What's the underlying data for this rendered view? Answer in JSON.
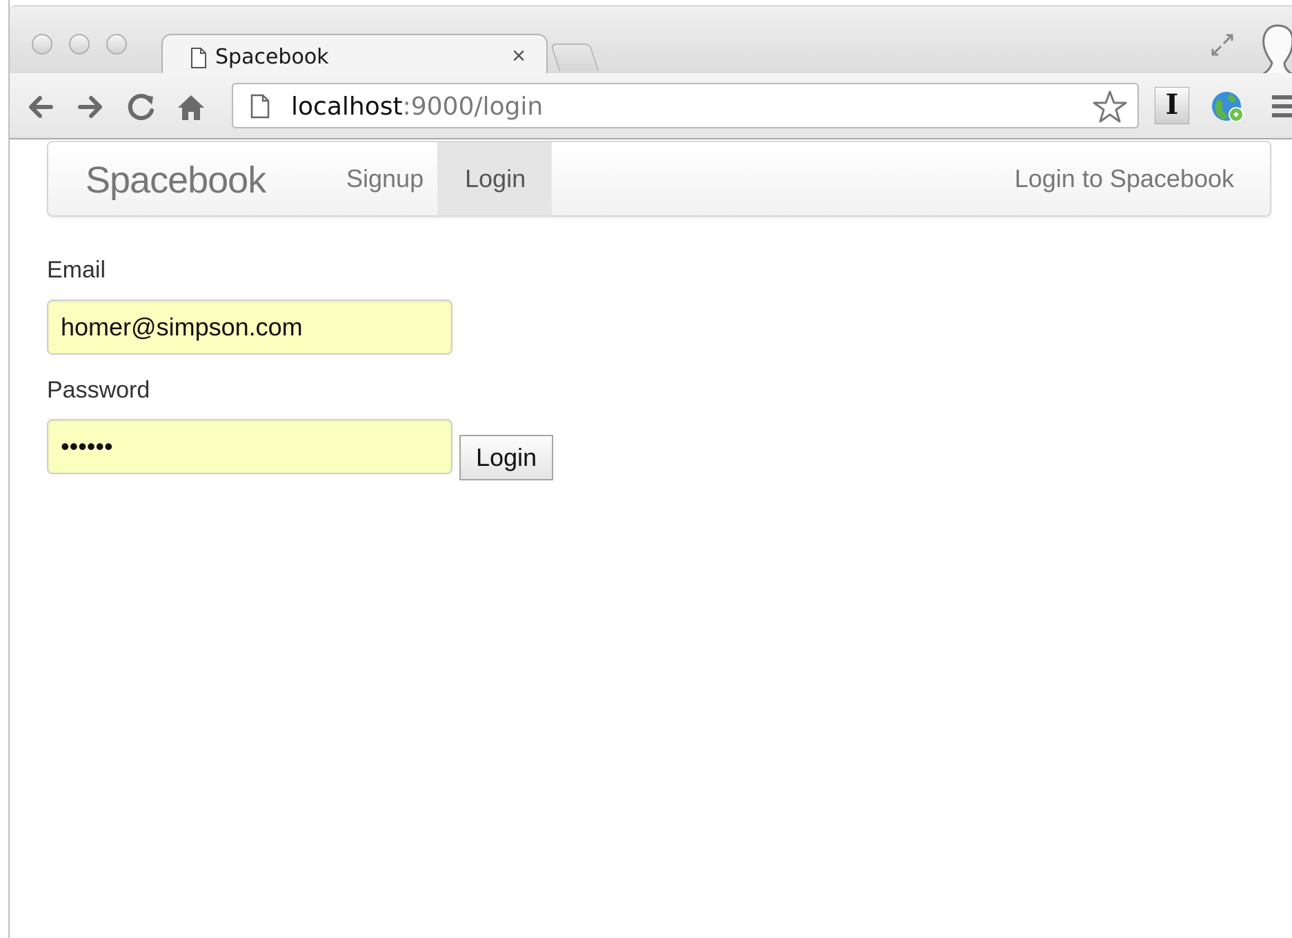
{
  "browser": {
    "tab_title": "Spacebook",
    "tab_close": "×",
    "url_host": "localhost",
    "url_rest": ":9000/login",
    "ext_label": "I"
  },
  "navbar": {
    "brand": "Spacebook",
    "items": [
      {
        "label": "Signup",
        "active": false
      },
      {
        "label": "Login",
        "active": true
      }
    ],
    "right_text": "Login to Spacebook"
  },
  "form": {
    "email_label": "Email",
    "email_value": "homer@simpson.com",
    "password_label": "Password",
    "password_value": "secret",
    "submit_label": "Login"
  },
  "colors": {
    "autofill_bg": "#fbffbd",
    "active_nav_bg": "#e5e5e5"
  }
}
